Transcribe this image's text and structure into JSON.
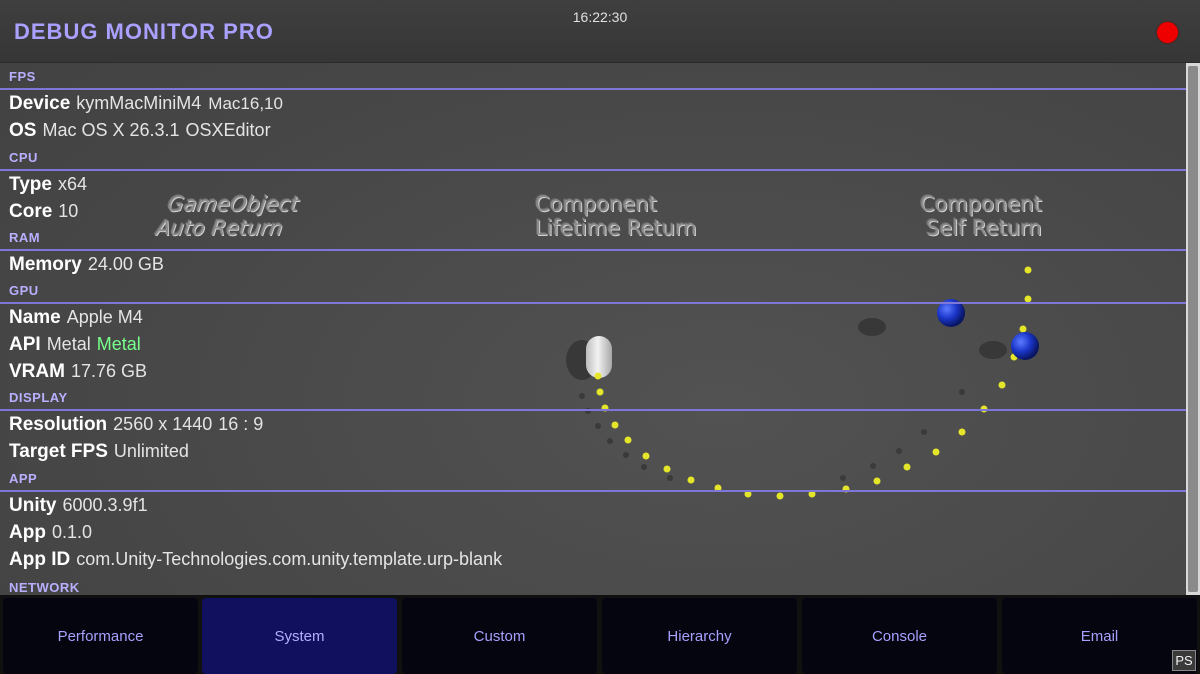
{
  "header": {
    "title": "DEBUG MONITOR PRO",
    "clock": "16:22:30"
  },
  "scene_labels": {
    "gameobject_line1": "GameObject",
    "gameobject_line2": "Auto Return",
    "component_lifetime_line1": "Component",
    "component_lifetime_line2": "Lifetime Return",
    "component_self_line1": "Component",
    "component_self_line2": "Self Return"
  },
  "sections": {
    "fps": "FPS",
    "cpu": "CPU",
    "ram": "RAM",
    "gpu": "GPU",
    "display": "DISPLAY",
    "app": "APP",
    "network": "NETWORK"
  },
  "device": {
    "device_key": "Device",
    "device_name": "kymMacMiniM4",
    "device_model": "Mac16,10",
    "os_key": "OS",
    "os_value": "Mac OS X 26.3.1",
    "os_platform": "OSXEditor"
  },
  "cpu": {
    "type_key": "Type",
    "type_value": "x64",
    "core_key": "Core",
    "core_value": "10"
  },
  "ram": {
    "memory_key": "Memory",
    "memory_value": "24.00 GB"
  },
  "gpu": {
    "name_key": "Name",
    "name_value": "Apple M4",
    "api_key": "API",
    "api_value": "Metal",
    "api_highlight": "Metal",
    "vram_key": "VRAM",
    "vram_value": "17.76 GB"
  },
  "display": {
    "resolution_key": "Resolution",
    "resolution_value": "2560 x 1440",
    "aspect": "16 : 9",
    "target_fps_key": "Target FPS",
    "target_fps_value": "Unlimited"
  },
  "app": {
    "unity_key": "Unity",
    "unity_value": "6000.3.9f1",
    "app_key": "App",
    "app_value": "0.1.0",
    "app_id_key": "App ID",
    "app_id_value": "com.Unity-Technologies.com.unity.template.urp-blank"
  },
  "tabs": [
    {
      "label": "Performance",
      "active": false
    },
    {
      "label": "System",
      "active": true
    },
    {
      "label": "Custom",
      "active": false
    },
    {
      "label": "Hierarchy",
      "active": false
    },
    {
      "label": "Console",
      "active": false
    },
    {
      "label": "Email",
      "active": false
    }
  ],
  "badge": "PS",
  "colors": {
    "accent": "#a9a0ff",
    "section_line": "#7f76d9",
    "active_tab": "#11105e",
    "record": "#ee0000",
    "highlight_green": "#78ff8c"
  }
}
